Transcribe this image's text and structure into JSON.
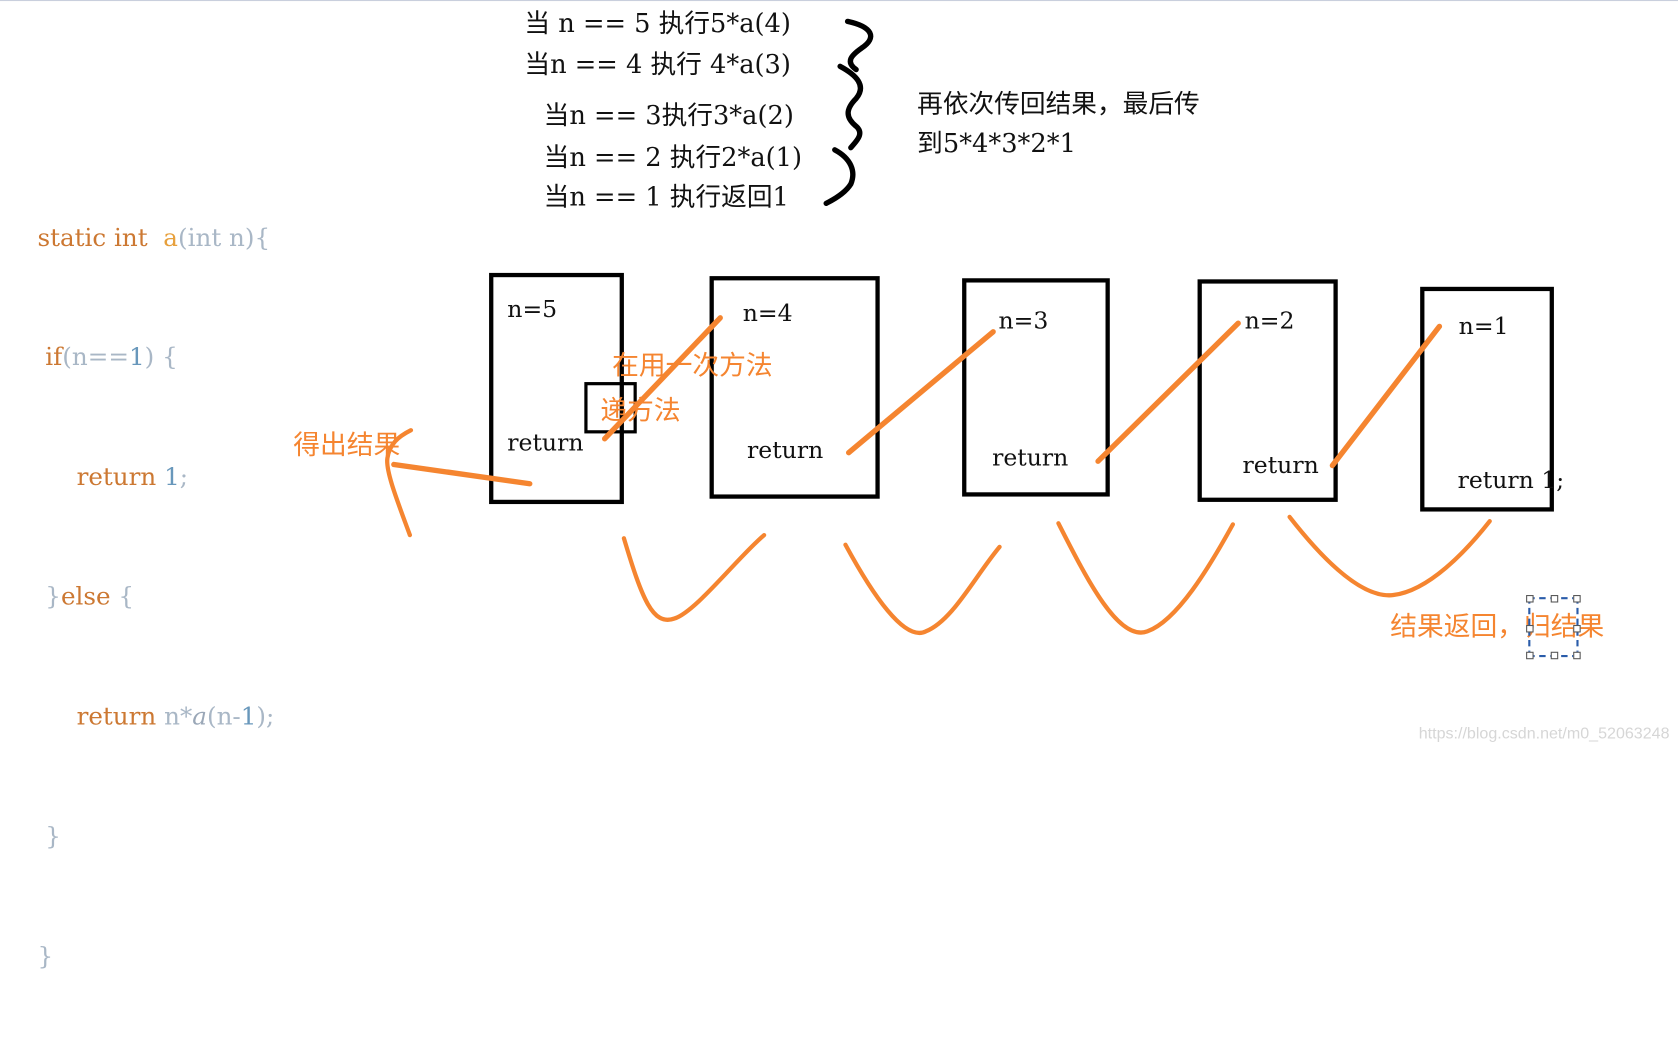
{
  "steps": [
    "当 n == 5 执行5*a(4)",
    "当n == 4 执行 4*a(3)",
    "当n == 3执行3*a(2)",
    "当n == 2 执行2*a(1)",
    "当n == 1 执行返回1"
  ],
  "note": {
    "line1": "再依次传回结果，最后传",
    "line2": "到5*4*3*2*1"
  },
  "code": {
    "line1": {
      "kw": "static int  ",
      "fn": "a",
      "rest": "(int n){"
    },
    "line2": {
      "kw": "if",
      "p1": "(n==",
      "num": "1",
      "p2": ") {"
    },
    "line3": {
      "kw": "return ",
      "num": "1",
      "p": ";"
    },
    "line4": {
      "p": "}",
      "kw": "else",
      "p2": " {"
    },
    "line5": {
      "kw": "return ",
      "p1": "n*",
      "it": "a",
      "p2": "(n-",
      "num": "1",
      "p3": ");"
    },
    "line6": "}",
    "line7": "}"
  },
  "frames": [
    {
      "n_label": "n=5",
      "ret_label": "return"
    },
    {
      "n_label": "n=4",
      "ret_label": "return"
    },
    {
      "n_label": "n=3",
      "ret_label": "return"
    },
    {
      "n_label": "n=2",
      "ret_label": "return"
    },
    {
      "n_label": "n=1",
      "ret_label": "return 1;"
    }
  ],
  "annotations": {
    "recurse_again": "在用一次方法",
    "recurse_method": "递方法",
    "get_result": "得出结果",
    "return_result": "结果返回，归结果"
  },
  "colors": {
    "accent": "#f58530",
    "ink": "#000000"
  },
  "watermark": "https://blog.csdn.net/m0_52063248"
}
